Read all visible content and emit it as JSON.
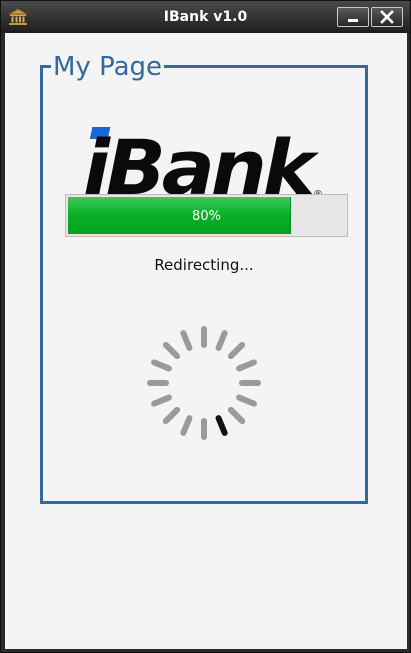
{
  "window": {
    "title": "IBank v1.0",
    "icon": "bank-icon",
    "controls": [
      "minimize-icon",
      "close-icon"
    ]
  },
  "group": {
    "legend": "My Page"
  },
  "logo": {
    "text": "iBank",
    "mark": "®"
  },
  "progress": {
    "value": 0.8,
    "label": "80%"
  },
  "status": {
    "text": "Redirecting..."
  },
  "colors": {
    "accent": "#35689e",
    "progress_fill": "#06b025",
    "logo_dot": "#1767d8",
    "spinner_segment": "#9a9a9a",
    "spinner_active": "#111111"
  }
}
